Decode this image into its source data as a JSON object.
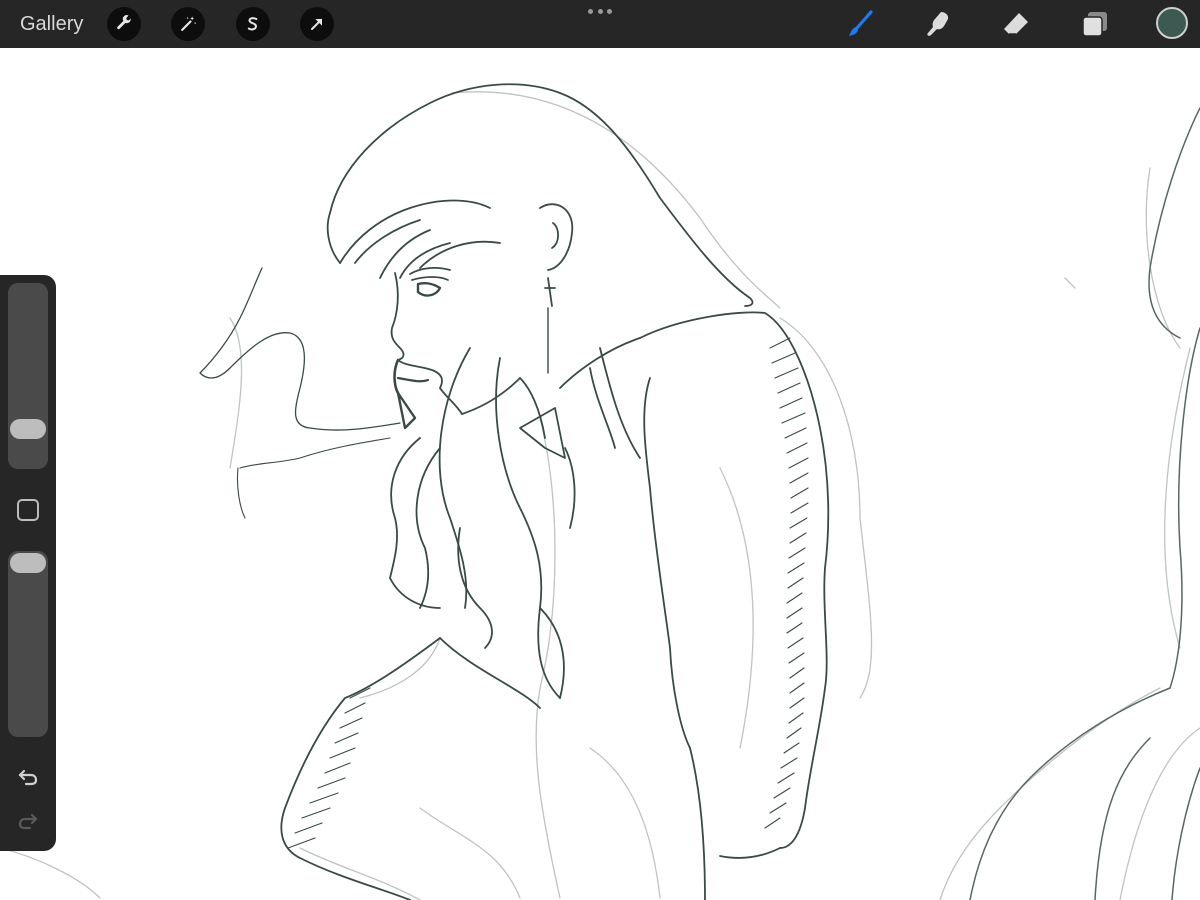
{
  "topbar": {
    "gallery_label": "Gallery",
    "left_tools": [
      {
        "icon": "wrench-icon",
        "name": "actions"
      },
      {
        "icon": "magic-wand-icon",
        "name": "adjustments"
      },
      {
        "icon": "selection-s-icon",
        "name": "selection"
      },
      {
        "icon": "arrow-cursor-icon",
        "name": "transform"
      }
    ],
    "right_tools": [
      {
        "icon": "brush-icon",
        "name": "brush",
        "active": true
      },
      {
        "icon": "smudge-icon",
        "name": "smudge"
      },
      {
        "icon": "eraser-icon",
        "name": "eraser"
      },
      {
        "icon": "layers-icon",
        "name": "layers"
      }
    ],
    "current_color": "#3d5a52",
    "active_tool_color": "#1e7cf2"
  },
  "sidebar": {
    "brush_size_level": 0.17,
    "opacity_level": 1.0,
    "undo_icon": "undo-icon",
    "redo_icon": "redo-icon"
  },
  "colors": {
    "toolbar_bg": "#262626",
    "ink": "#3b4a47",
    "sketch_light": "#b9bdbc"
  }
}
